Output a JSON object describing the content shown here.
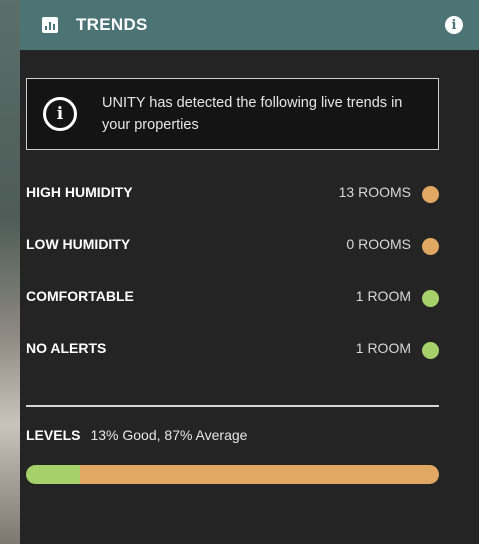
{
  "header": {
    "title": "TRENDS",
    "chart_icon": "bar-chart-icon",
    "info_icon": "info-icon",
    "color": "#4d7475"
  },
  "notice": {
    "icon": "info-circle-icon",
    "text": "UNITY has detected the following live trends in your properties"
  },
  "trends": [
    {
      "label": "HIGH HUMIDITY",
      "count": "13 ROOMS",
      "status_color": "#e0a862"
    },
    {
      "label": "LOW HUMIDITY",
      "count": "0 ROOMS",
      "status_color": "#e0a862"
    },
    {
      "label": "COMFORTABLE",
      "count": "1 ROOM",
      "status_color": "#a6d16a"
    },
    {
      "label": "NO ALERTS",
      "count": "1 ROOM",
      "status_color": "#a6d16a"
    }
  ],
  "levels": {
    "label": "LEVELS",
    "summary": "13% Good, 87% Average",
    "good_percent": 13,
    "average_percent": 87,
    "good_color": "#a6d16a",
    "average_color": "#e0a862"
  }
}
